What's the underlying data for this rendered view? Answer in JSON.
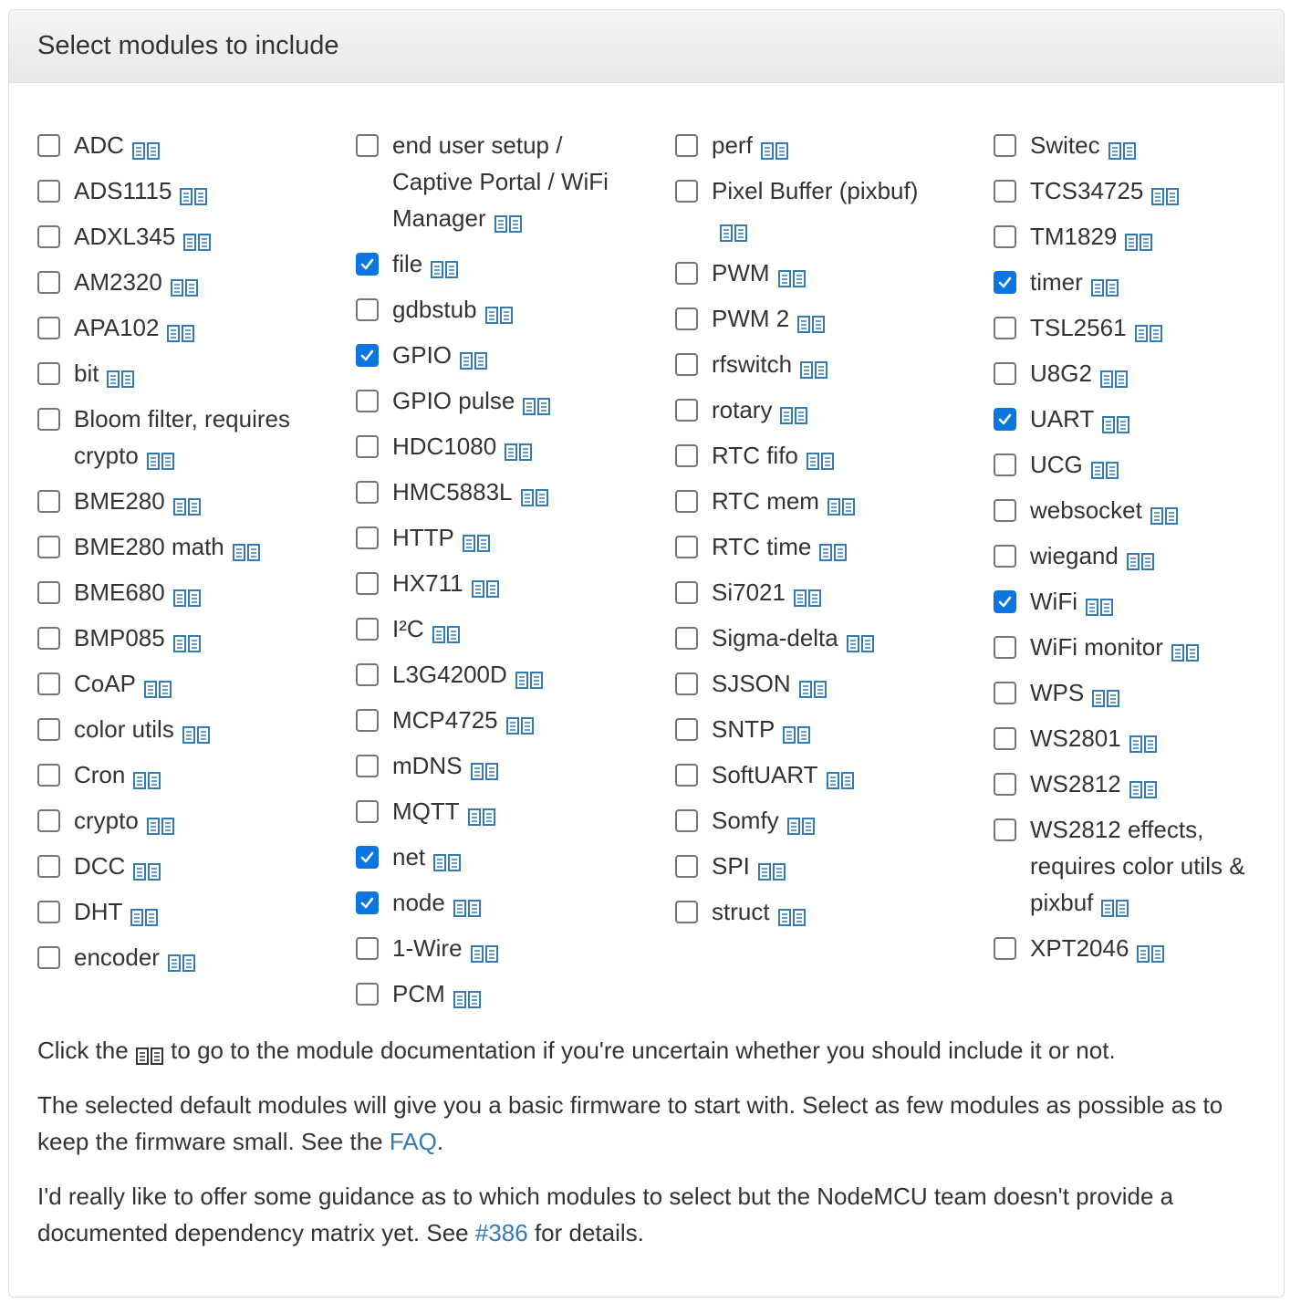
{
  "panel": {
    "title": "Select modules to include"
  },
  "columns": [
    [
      {
        "label": "ADC",
        "checked": false
      },
      {
        "label": "ADS1115",
        "checked": false
      },
      {
        "label": "ADXL345",
        "checked": false
      },
      {
        "label": "AM2320",
        "checked": false
      },
      {
        "label": "APA102",
        "checked": false
      },
      {
        "label": "bit",
        "checked": false
      },
      {
        "label": "Bloom filter, requires crypto",
        "checked": false
      },
      {
        "label": "BME280",
        "checked": false
      },
      {
        "label": "BME280 math",
        "checked": false
      },
      {
        "label": "BME680",
        "checked": false
      },
      {
        "label": "BMP085",
        "checked": false
      },
      {
        "label": "CoAP",
        "checked": false
      },
      {
        "label": "color utils",
        "checked": false
      },
      {
        "label": "Cron",
        "checked": false
      },
      {
        "label": "crypto",
        "checked": false
      },
      {
        "label": "DCC",
        "checked": false
      },
      {
        "label": "DHT",
        "checked": false
      },
      {
        "label": "encoder",
        "checked": false
      }
    ],
    [
      {
        "label": "end user setup / Captive Portal / WiFi Manager",
        "checked": false
      },
      {
        "label": "file",
        "checked": true
      },
      {
        "label": "gdbstub",
        "checked": false
      },
      {
        "label": "GPIO",
        "checked": true
      },
      {
        "label": "GPIO pulse",
        "checked": false
      },
      {
        "label": "HDC1080",
        "checked": false
      },
      {
        "label": "HMC5883L",
        "checked": false
      },
      {
        "label": "HTTP",
        "checked": false
      },
      {
        "label": "HX711",
        "checked": false
      },
      {
        "label": "I²C",
        "checked": false
      },
      {
        "label": "L3G4200D",
        "checked": false
      },
      {
        "label": "MCP4725",
        "checked": false
      },
      {
        "label": "mDNS",
        "checked": false
      },
      {
        "label": "MQTT",
        "checked": false
      },
      {
        "label": "net",
        "checked": true
      },
      {
        "label": "node",
        "checked": true
      },
      {
        "label": "1-Wire",
        "checked": false
      },
      {
        "label": "PCM",
        "checked": false
      }
    ],
    [
      {
        "label": "perf",
        "checked": false
      },
      {
        "label": "Pixel Buffer (pixbuf)",
        "checked": false
      },
      {
        "label": "PWM",
        "checked": false
      },
      {
        "label": "PWM 2",
        "checked": false
      },
      {
        "label": "rfswitch",
        "checked": false
      },
      {
        "label": "rotary",
        "checked": false
      },
      {
        "label": "RTC fifo",
        "checked": false
      },
      {
        "label": "RTC mem",
        "checked": false
      },
      {
        "label": "RTC time",
        "checked": false
      },
      {
        "label": "Si7021",
        "checked": false
      },
      {
        "label": "Sigma-delta",
        "checked": false
      },
      {
        "label": "SJSON",
        "checked": false
      },
      {
        "label": "SNTP",
        "checked": false
      },
      {
        "label": "SoftUART",
        "checked": false
      },
      {
        "label": "Somfy",
        "checked": false
      },
      {
        "label": "SPI",
        "checked": false
      },
      {
        "label": "struct",
        "checked": false
      }
    ],
    [
      {
        "label": "Switec",
        "checked": false
      },
      {
        "label": "TCS34725",
        "checked": false
      },
      {
        "label": "TM1829",
        "checked": false
      },
      {
        "label": "timer",
        "checked": true
      },
      {
        "label": "TSL2561",
        "checked": false
      },
      {
        "label": "U8G2",
        "checked": false
      },
      {
        "label": "UART",
        "checked": true
      },
      {
        "label": "UCG",
        "checked": false
      },
      {
        "label": "websocket",
        "checked": false
      },
      {
        "label": "wiegand",
        "checked": false
      },
      {
        "label": "WiFi",
        "checked": true
      },
      {
        "label": "WiFi monitor",
        "checked": false
      },
      {
        "label": "WPS",
        "checked": false
      },
      {
        "label": "WS2801",
        "checked": false
      },
      {
        "label": "WS2812",
        "checked": false
      },
      {
        "label": "WS2812 effects, requires color utils & pixbuf",
        "checked": false
      },
      {
        "label": "XPT2046",
        "checked": false
      }
    ]
  ],
  "help": {
    "p1_before": "Click the",
    "p1_after": "to go to the module documentation if you're uncertain whether you should include it or not.",
    "p2_before": "The selected default modules will give you a basic firmware to start with. Select as few modules as possible as to keep the firmware small. See the",
    "p2_link": "FAQ",
    "p2_after": ".",
    "p3_before": "I'd really like to offer some guidance as to which modules to select but the NodeMCU team doesn't provide a documented dependency matrix yet. See",
    "p3_link": "#386",
    "p3_after": "for details."
  },
  "colors": {
    "accent": "#0b75e0",
    "link": "#337ab7",
    "icon": "#337ab7",
    "text": "#333333",
    "border": "#dddddd"
  },
  "icons": {
    "doc": "book-icon",
    "check": "checkmark-icon"
  }
}
